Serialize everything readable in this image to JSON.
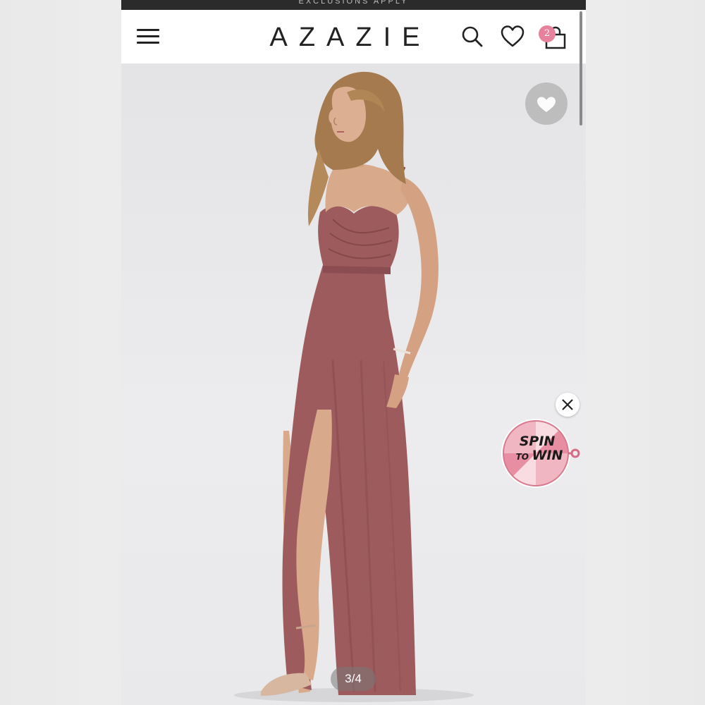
{
  "promo": {
    "text": "EXCLUSIONS APPLY"
  },
  "header": {
    "logo": "AZAZIE",
    "cart_count": "2",
    "icons": [
      "menu-icon",
      "search-icon",
      "heart-icon",
      "shopping-bag-icon"
    ]
  },
  "gallery": {
    "page_indicator": "3/4",
    "current_page": 3,
    "total_pages": 4,
    "dress_color": "#9d5b5e"
  },
  "popup": {
    "spin_line1": "SPIN",
    "spin_line2_a": "TO",
    "spin_line2_b": "WIN"
  },
  "colors": {
    "accent_pink": "#e7829a",
    "dress": "#9d5b5e",
    "header_text": "#222222"
  }
}
